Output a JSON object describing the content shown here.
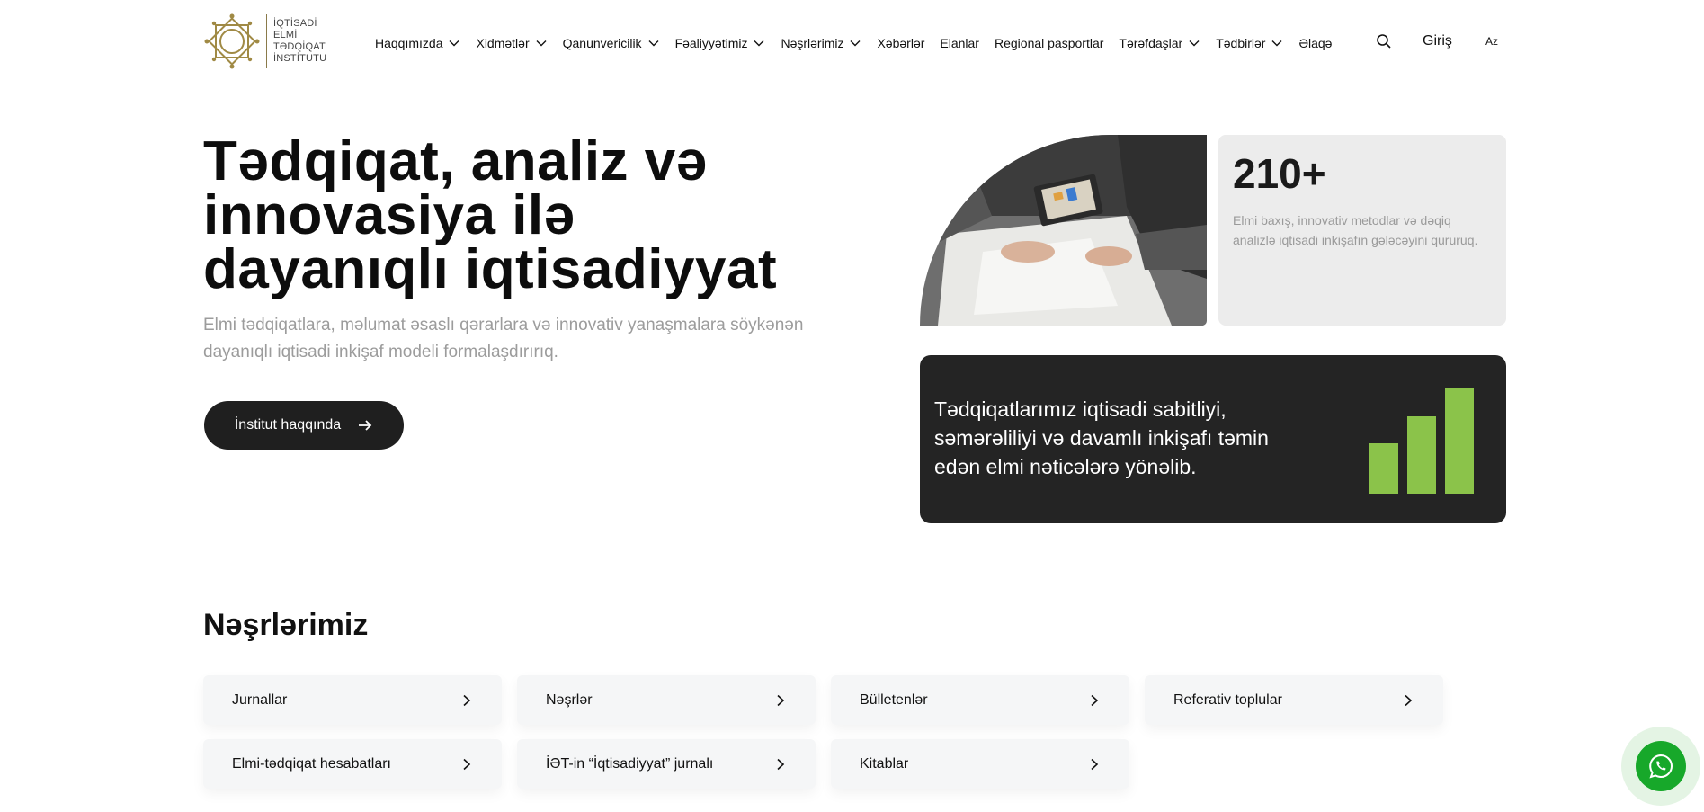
{
  "logo": {
    "lines": [
      "İQTİSADİ",
      "ELMİ",
      "TƏDQİQAT",
      "İNSTİTUTU"
    ]
  },
  "nav": {
    "items": [
      {
        "label": "Haqqımızda",
        "dropdown": true
      },
      {
        "label": "Xidmətlər",
        "dropdown": true
      },
      {
        "label": "Qanunvericilik",
        "dropdown": true
      },
      {
        "label": "Fəaliyyətimiz",
        "dropdown": true
      },
      {
        "label": "Nəşrlərimiz",
        "dropdown": true
      },
      {
        "label": "Xəbərlər",
        "dropdown": false
      },
      {
        "label": "Elanlar",
        "dropdown": false
      },
      {
        "label": "Regional pasportlar",
        "dropdown": false
      },
      {
        "label": "Tərəfdaşlar",
        "dropdown": true
      },
      {
        "label": "Tədbirlər",
        "dropdown": true
      },
      {
        "label": "Əlaqə",
        "dropdown": false
      }
    ],
    "login_label": "Giriş",
    "language": "Az",
    "search_icon": "search-icon"
  },
  "hero": {
    "title": "Tədqiqat, analiz və innovasiya ilə dayanıqlı iqtisadiyyat",
    "subtitle": "Elmi tədqiqatlara, məlumat əsaslı qərarlara və innovativ yanaşmalara söykənən dayanıqlı iqtisadi inkişaf modeli formalaşdırırıq.",
    "button_label": "İnstitut haqqında"
  },
  "stat": {
    "number": "210+",
    "text": "Elmi baxış, innovativ metodlar və dəqiq analizlə iqtisadi inkişafın gələcəyini qururuq."
  },
  "dark_card": {
    "text": "Tədqiqatlarımız iqtisadi sabitliyi, səmərəliliyi və davamlı inkişafı təmin edən elmi nəticələrə yönəlib.",
    "accent": "#8bc34a"
  },
  "publications": {
    "title": "Nəşrlərimiz",
    "items": [
      "Jurnallar",
      "Nəşrlər",
      "Bülletenlər",
      "Referativ toplular",
      "Elmi-tədqiqat hesabatları",
      "İƏT-in “İqtisadiyyat” jurnalı",
      "Kitablar"
    ]
  },
  "whatsapp": {
    "icon": "whatsapp-icon",
    "color": "#17a82a"
  }
}
